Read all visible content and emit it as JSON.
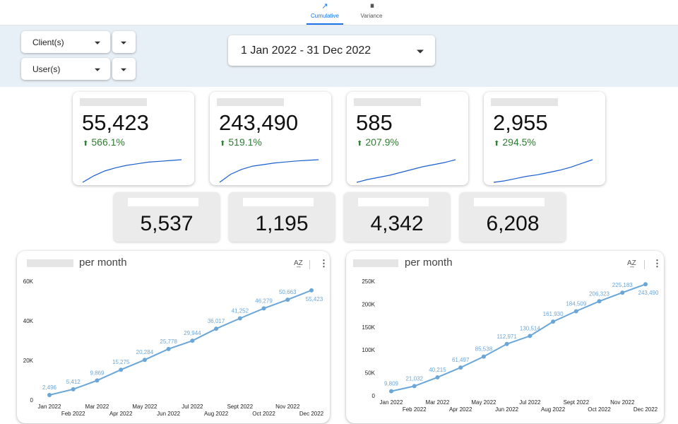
{
  "tabs": [
    {
      "label": "Cumulative",
      "icon": "trending-up-icon",
      "glyph": "↗",
      "active": true
    },
    {
      "label": "Variance",
      "icon": "bar-chart-icon",
      "glyph": "▮▮",
      "active": false
    }
  ],
  "filters": {
    "clients": "Client(s)",
    "users": "User(s)",
    "date_range": "1 Jan 2022 - 31 Dec 2022"
  },
  "kpis": [
    {
      "value": "55,423",
      "delta": "566.1%",
      "spark": [
        2,
        10,
        16,
        20,
        23,
        25,
        27,
        28,
        29,
        30
      ]
    },
    {
      "value": "243,490",
      "delta": "519.1%",
      "spark": [
        3,
        8,
        11,
        13,
        14,
        15,
        15.6,
        16.2,
        16.6,
        17
      ]
    },
    {
      "value": "585",
      "delta": "207.9%",
      "spark": [
        2,
        4,
        5.5,
        7,
        9,
        11,
        13,
        14.5,
        16,
        18
      ]
    },
    {
      "value": "2,955",
      "delta": "294.5%",
      "spark": [
        2,
        3,
        4.5,
        6,
        7,
        8.5,
        10,
        12,
        14.5,
        17
      ]
    }
  ],
  "kpi_style": {
    "arrow_glyph": "⬆",
    "line_color": "#1a5fd0",
    "positive_color": "#2e7d32"
  },
  "stats": [
    "5,537",
    "1,195",
    "4,342",
    "6,208"
  ],
  "panels": {
    "title": "per month",
    "sort_icon": "sort-az-icon",
    "sort_glyph": "A͢Z",
    "more_icon": "more-vert-icon",
    "more_glyph": "⋮"
  },
  "chart_data": [
    {
      "type": "line",
      "title": "per month",
      "categories": [
        "Jan 2022",
        "Feb 2022",
        "Mar 2022",
        "Apr 2022",
        "May 2022",
        "Jun 2022",
        "Jul 2022",
        "Aug 2022",
        "Sept 2022",
        "Oct 2022",
        "Nov 2022",
        "Dec 2022"
      ],
      "values": [
        2496,
        5412,
        9869,
        15275,
        20284,
        25778,
        29944,
        36017,
        41252,
        46279,
        50663,
        55423
      ],
      "labels": [
        "2,496",
        "5,412",
        "9,869",
        "15,275",
        "20,284",
        "25,778",
        "29,944",
        "36,017",
        "41,252",
        "46,279",
        "50,663",
        "55,423"
      ],
      "yticks": [
        0,
        20000,
        40000,
        60000
      ],
      "ytick_labels": [
        "0",
        "20K",
        "40K",
        "60K"
      ],
      "ylim": [
        0,
        60000
      ],
      "color": "#6aa6d8",
      "grid": false
    },
    {
      "type": "line",
      "title": "per month",
      "categories": [
        "Jan 2022",
        "Feb 2022",
        "Mar 2022",
        "Apr 2022",
        "May 2022",
        "Jun 2022",
        "Jul 2022",
        "Aug 2022",
        "Sept 2022",
        "Oct 2022",
        "Nov 2022",
        "Dec 2022"
      ],
      "values": [
        9809,
        21032,
        40215,
        61497,
        85538,
        112971,
        130514,
        161930,
        184509,
        206323,
        225183,
        243490
      ],
      "labels": [
        "9,809",
        "21,032",
        "40,215",
        "61,497",
        "85,538",
        "112,971",
        "130,514",
        "161,930",
        "184,509",
        "206,323",
        "225,183",
        "243,490"
      ],
      "yticks": [
        0,
        50000,
        100000,
        150000,
        200000,
        250000
      ],
      "ytick_labels": [
        "0",
        "50K",
        "100K",
        "150K",
        "200K",
        "250K"
      ],
      "ylim": [
        0,
        250000
      ],
      "color": "#6aa6d8",
      "grid": false
    }
  ]
}
